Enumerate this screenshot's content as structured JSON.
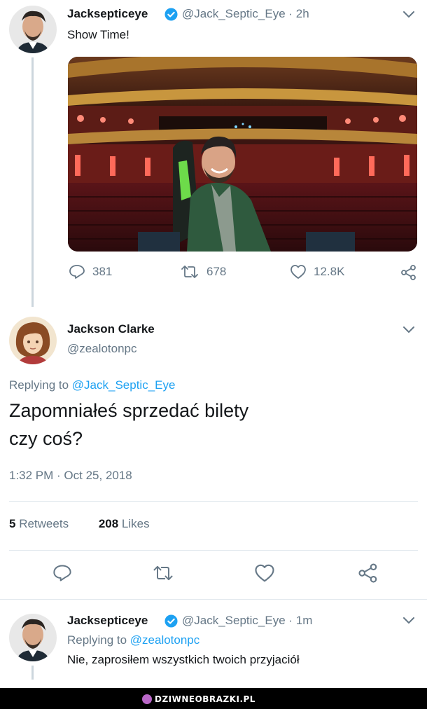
{
  "tweet1": {
    "author": "Jacksepticeye",
    "handle": "@Jack_Septic_Eye",
    "time": "· 2h",
    "text": "Show Time!",
    "replies": "381",
    "retweets": "678",
    "likes": "12.8K"
  },
  "tweet2": {
    "author": "Jackson Clarke",
    "handle": "@zealotonpc",
    "replying_prefix": "Replying to ",
    "replying_to": "@Jack_Septic_Eye",
    "text_line1": "Zapomniałeś sprzedać bilety",
    "text_line2": "czy coś?",
    "timestamp": "1:32 PM · Oct 25, 2018",
    "retweets_count": "5",
    "retweets_label": "Retweets",
    "likes_count": "208",
    "likes_label": "Likes"
  },
  "tweet3": {
    "author": "Jacksepticeye",
    "handle": "@Jack_Septic_Eye",
    "time": "· 1m",
    "replying_prefix": "Replying to ",
    "replying_to": "@zealotonpc",
    "text": "Nie, zaprosiłem wszystkich twoich przyjaciół"
  },
  "footer": {
    "watermark": "DZIWNEOBRAZKI.PL"
  },
  "colors": {
    "verified": "#1da1f2",
    "mention": "#1da1f2",
    "secondary_text": "#657786"
  }
}
